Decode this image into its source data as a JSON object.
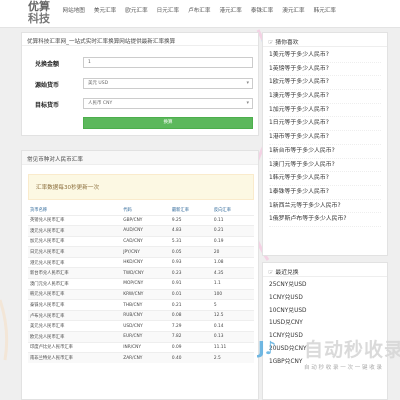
{
  "header": {
    "logo_line1": "优算",
    "logo_line2": "科技",
    "nav": [
      "网站地图",
      "美元汇率",
      "欧元汇率",
      "日元汇率",
      "卢布汇率",
      "港元汇率",
      "泰铢汇率",
      "澳元汇率",
      "韩元汇率"
    ]
  },
  "converter": {
    "title": "优算科技汇率网_一站式实时汇率换算网站提供最新汇率换算",
    "amount_label": "兑换金额",
    "amount_value": "1",
    "source_label": "源始货币",
    "source_value": "美元 USD",
    "target_label": "目标货币",
    "target_value": "人民币 CNY",
    "button_label": "换算"
  },
  "rates": {
    "title": "常见币种对人民币汇率",
    "notice": "汇率数据每30秒更新一次",
    "columns": [
      "货币名称",
      "代码",
      "最新汇率",
      "反向汇率"
    ],
    "rows": [
      [
        "英镑兑人民币汇率",
        "GBP/CNY",
        "9.25",
        "0.11"
      ],
      [
        "澳元兑人民币汇率",
        "AUD/CNY",
        "4.83",
        "0.21"
      ],
      [
        "加元兑人民币汇率",
        "CAD/CNY",
        "5.31",
        "0.19"
      ],
      [
        "日元兑人民币汇率",
        "JPY/CNY",
        "0.05",
        "20"
      ],
      [
        "港元兑人民币汇率",
        "HKD/CNY",
        "0.93",
        "1.08"
      ],
      [
        "新台币兑人民币汇率",
        "TWD/CNY",
        "0.23",
        "4.35"
      ],
      [
        "澳门元兑人民币汇率",
        "MOP/CNY",
        "0.91",
        "1.1"
      ],
      [
        "韩元兑人民币汇率",
        "KRW/CNY",
        "0.01",
        "100"
      ],
      [
        "泰铢兑人民币汇率",
        "THB/CNY",
        "0.21",
        "5"
      ],
      [
        "卢布兑人民币汇率",
        "RUB/CNY",
        "0.08",
        "12.5"
      ],
      [
        "美元兑人民币汇率",
        "USD/CNY",
        "7.29",
        "0.14"
      ],
      [
        "欧元兑人民币汇率",
        "EUR/CNY",
        "7.82",
        "0.13"
      ],
      [
        "印度卢比兑人民币汇率",
        "INR/CNY",
        "0.09",
        "11.11"
      ],
      [
        "南非兰特兑人民币汇率",
        "ZAR/CNY",
        "0.40",
        "2.5"
      ]
    ]
  },
  "favorites": {
    "title": "猜你喜欢",
    "items": [
      "1美元等于多少人民币?",
      "1英镑等于多少人民币?",
      "1欧元等于多少人民币?",
      "1澳元等于多少人民币?",
      "1加元等于多少人民币?",
      "1日元等于多少人民币?",
      "1港币等于多少人民币?",
      "1新台币等于多少人民币?",
      "1澳门元等于多少人民币?",
      "1韩元等于多少人民币?",
      "1泰铢等于多少人民币?",
      "1新西兰元等于多少人民币?",
      "1俄罗斯卢布等于多少人民币?"
    ]
  },
  "recent": {
    "title": "最近兑换",
    "items": [
      "25CNY兑USD",
      "1CNY兑USD",
      "10CNY兑USD",
      "1USD兑CNY",
      "1CNY兑USD",
      "20USD兑CNY",
      "1GBP兑CNY"
    ]
  },
  "watermark": {
    "text": "自动秒收录",
    "sub": "自 动 秒 收 录 一 次 一 键 收 录"
  },
  "colors": {
    "accent_green": "#5cb85c",
    "link_blue": "#2a6496",
    "notice_bg": "#fcf8e3"
  }
}
